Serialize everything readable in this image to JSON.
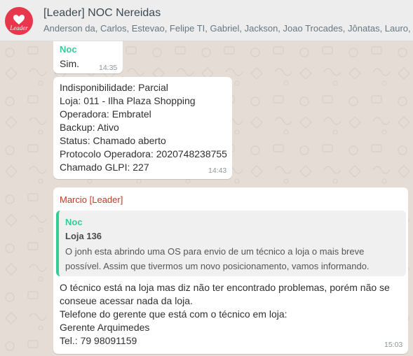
{
  "header": {
    "title": "[Leader] NOC Nereidas",
    "members": "Anderson da, Carlos, Estevao, Felipe TI, Gabriel, Jackson, Joao Trocades, Jônatas, Lauro, Leandro",
    "avatar_text": "Leader"
  },
  "messages": [
    {
      "sender": "Noc",
      "text": "Sim.",
      "time": "14:35"
    },
    {
      "lines": [
        "Indisponibilidade: Parcial",
        "Loja: 011 - Ilha Plaza Shopping",
        "Operadora: Embratel",
        "Backup: Ativo",
        "Status: Chamado aberto",
        "Protocolo Operadora: 2020748238755",
        "Chamado GLPI: 227"
      ],
      "time": "14:43"
    },
    {
      "sender": "Marcio [Leader]",
      "quote": {
        "author": "Noc",
        "title": "Loja 136",
        "body": "O jonh esta abrindo uma OS para envio de um técnico a loja o mais breve possível. Assim que tivermos um novo posicionamento, vamos informando."
      },
      "lines": [
        "O técnico está na loja mas diz não ter encontrado problemas, porém não se conseue acessar nada da loja.",
        "Telefone do gerente que está com o técnico em loja:",
        "Gerente Arquimedes",
        "Tel.:  79 98091159"
      ],
      "time": "15:03"
    }
  ],
  "colors": {
    "chat_background": "#e5ddd5",
    "header_background": "#ededed",
    "noc_name": "#35cd96",
    "marcio_name": "#c0392b",
    "avatar": "#e8364d"
  }
}
